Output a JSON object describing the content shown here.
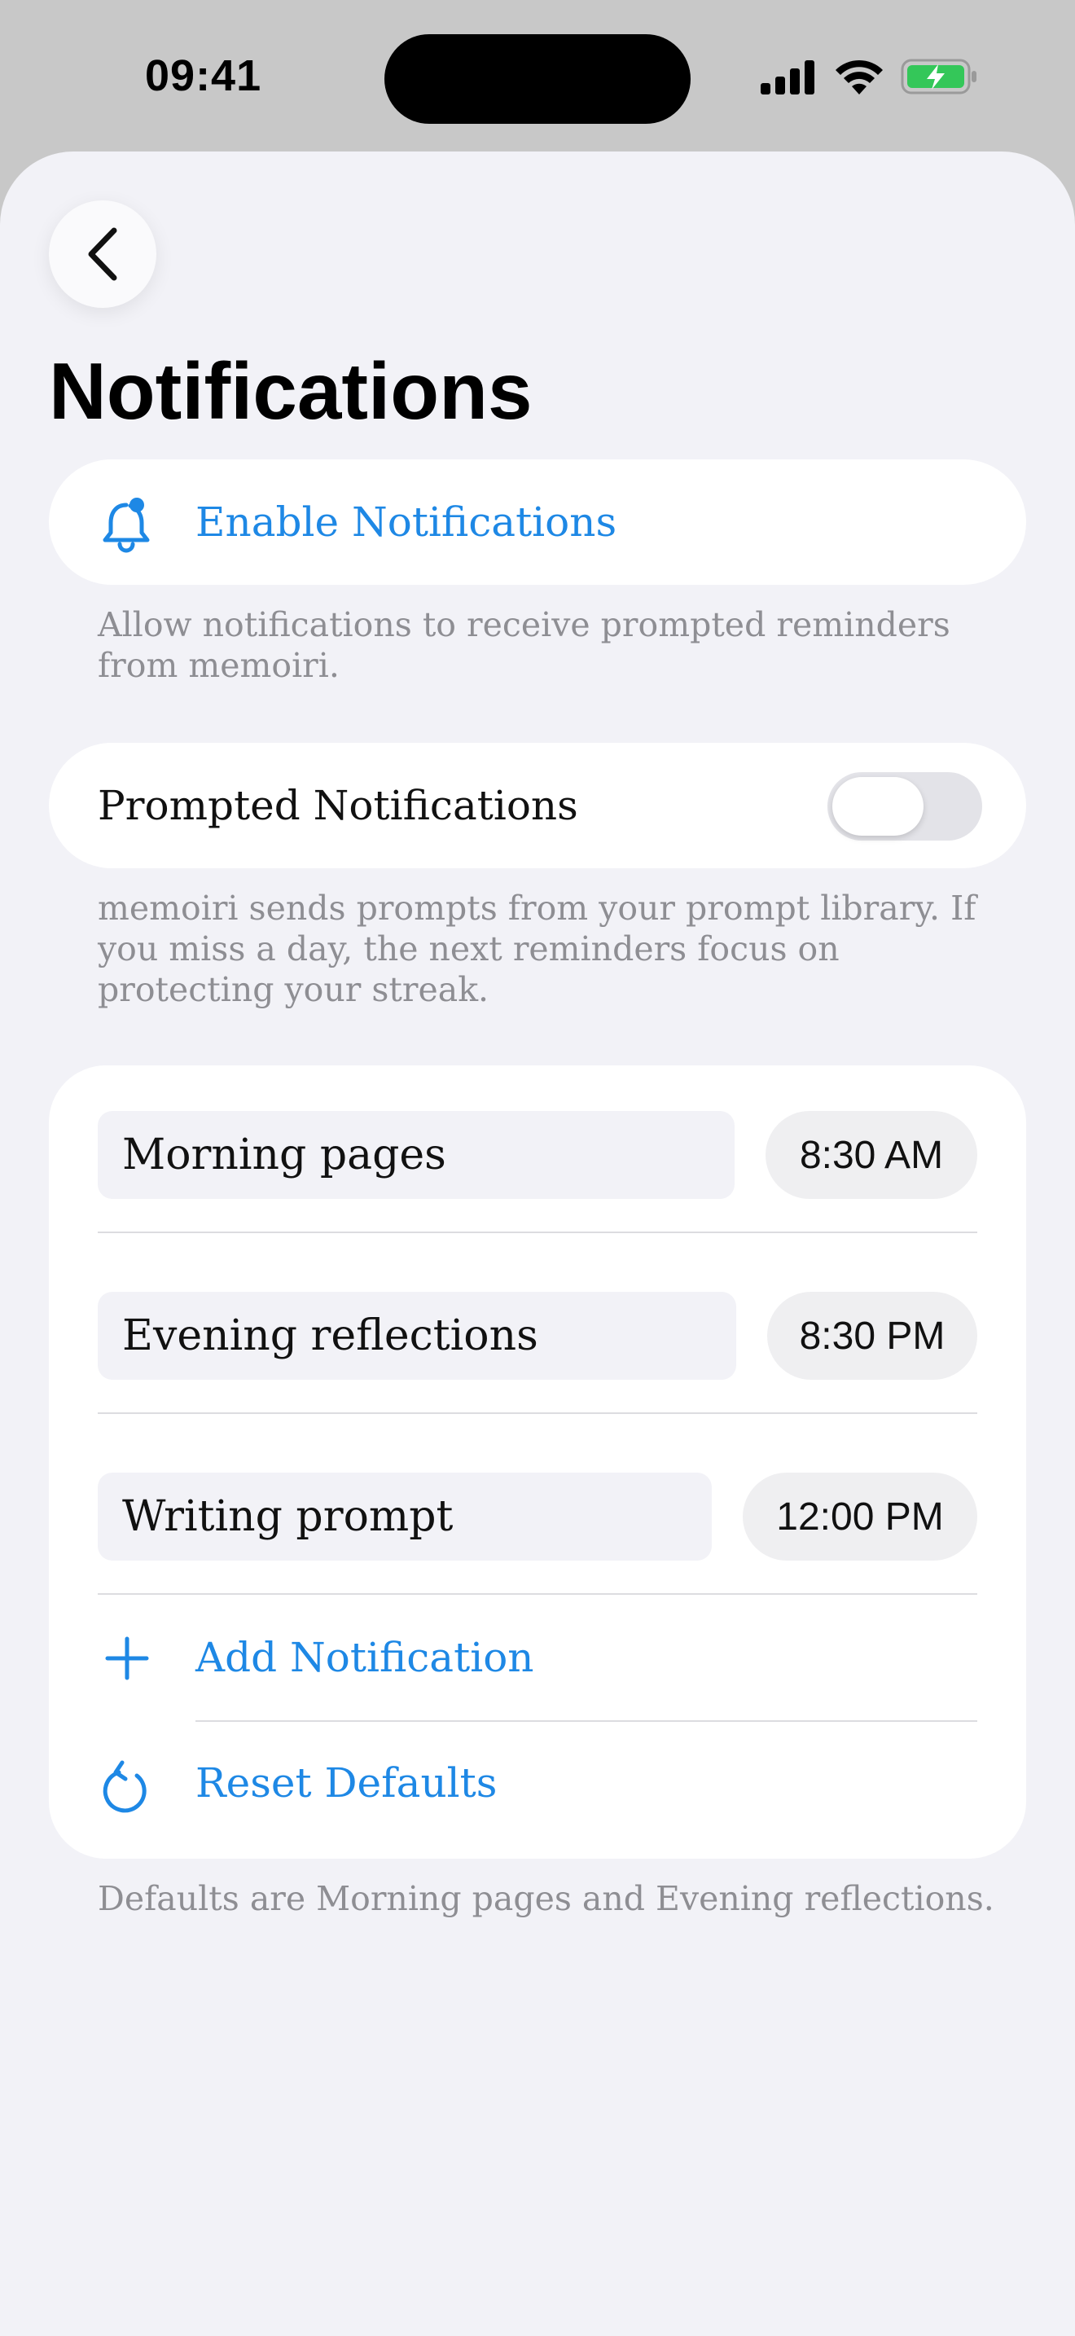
{
  "status_bar": {
    "time": "09:41"
  },
  "header": {
    "title": "Notifications"
  },
  "enable_section": {
    "label": "Enable Notifications",
    "footnote": "Allow notifications to receive prompted reminders from memoiri."
  },
  "prompted_section": {
    "label": "Prompted Notifications",
    "enabled": false,
    "footnote": "memoiri sends prompts from your prompt library. If you miss a day, the next reminders focus on protecting your streak."
  },
  "notifications": [
    {
      "name": "Morning pages",
      "time": "8:30 AM"
    },
    {
      "name": "Evening reflections",
      "time": "8:30 PM"
    },
    {
      "name": "Writing prompt",
      "time": "12:00 PM"
    }
  ],
  "actions": {
    "add_label": "Add Notification",
    "reset_label": "Reset Defaults"
  },
  "defaults_footnote": "Defaults are Morning pages and Evening reflections.",
  "colors": {
    "accent": "#1e88e5",
    "background": "#f2f2f7",
    "battery": "#34c759"
  }
}
